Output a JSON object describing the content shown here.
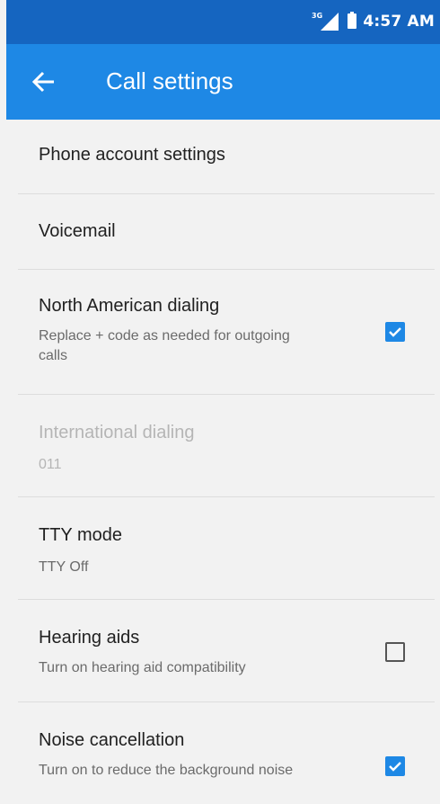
{
  "status_bar": {
    "time": "4:57 AM",
    "network_label": "3G"
  },
  "app_bar": {
    "title": "Call settings",
    "back_icon": "arrow-back-icon"
  },
  "settings": [
    {
      "label": "Phone account settings"
    },
    {
      "label": "Voicemail"
    },
    {
      "label": "North American dialing",
      "summary": "Replace + code as needed for outgoing calls",
      "checkbox": true
    },
    {
      "label": "International dialing",
      "summary": "011",
      "disabled": true
    },
    {
      "label": "TTY mode",
      "summary": "TTY Off"
    },
    {
      "label": "Hearing aids",
      "summary": "Turn on hearing aid compatibility",
      "checkbox": false
    },
    {
      "label": "Noise cancellation",
      "summary": "Turn on to reduce the background noise",
      "checkbox": true
    }
  ],
  "colors": {
    "status_bar": "#1565c0",
    "app_bar": "#1e88e5",
    "accent": "#1e88e5",
    "background": "#f2f2f2"
  }
}
